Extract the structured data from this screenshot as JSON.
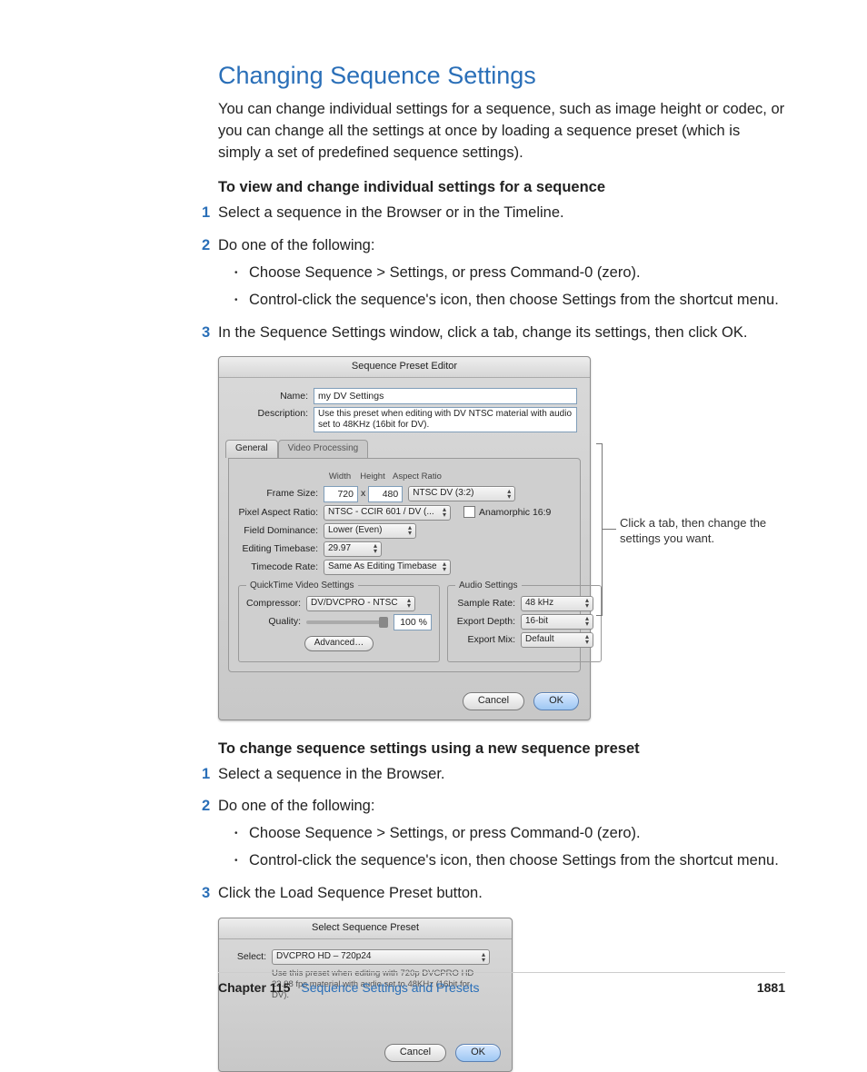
{
  "section_title": "Changing Sequence Settings",
  "intro": "You can change individual settings for a sequence, such as image height or codec, or you can change all the settings at once by loading a sequence preset (which is simply a set of predefined sequence settings).",
  "procA_head": "To view and change individual settings for a sequence",
  "procA_steps": [
    "Select a sequence in the Browser or in the Timeline.",
    "Do one of the following:",
    "In the Sequence Settings window, click a tab, change its settings, then click OK."
  ],
  "procA_sub": [
    "Choose Sequence > Settings, or press Command-0 (zero).",
    "Control-click the sequence's icon, then choose Settings from the shortcut menu."
  ],
  "dialog1": {
    "title": "Sequence Preset Editor",
    "name_label": "Name:",
    "name_value": "my DV Settings",
    "desc_label": "Description:",
    "desc_value": "Use this preset when editing with DV NTSC material with audio set to 48KHz (16bit for DV).",
    "tabs": [
      "General",
      "Video Processing"
    ],
    "heads": {
      "width": "Width",
      "height": "Height",
      "aspect": "Aspect Ratio"
    },
    "frame_label": "Frame Size:",
    "frame_w": "720",
    "frame_x": "x",
    "frame_h": "480",
    "frame_aspect": "NTSC DV (3:2)",
    "par_label": "Pixel Aspect Ratio:",
    "par_value": "NTSC - CCIR 601 / DV (...",
    "anamorphic": "Anamorphic 16:9",
    "field_label": "Field Dominance:",
    "field_value": "Lower (Even)",
    "timebase_label": "Editing Timebase:",
    "timebase_value": "29.97",
    "tcrate_label": "Timecode Rate:",
    "tcrate_value": "Same As Editing Timebase",
    "qt_legend": "QuickTime Video Settings",
    "compressor_label": "Compressor:",
    "compressor_value": "DV/DVCPRO - NTSC",
    "quality_label": "Quality:",
    "quality_value": "100 %",
    "advanced": "Advanced…",
    "audio_legend": "Audio Settings",
    "sample_label": "Sample Rate:",
    "sample_value": "48 kHz",
    "depth_label": "Export Depth:",
    "depth_value": "16-bit",
    "mix_label": "Export Mix:",
    "mix_value": "Default",
    "cancel": "Cancel",
    "ok": "OK"
  },
  "callout": "Click a tab, then change the settings you want.",
  "procB_head": "To change sequence settings using a new sequence preset",
  "procB_steps": [
    "Select a sequence in the Browser.",
    "Do one of the following:",
    "Click the Load Sequence Preset button."
  ],
  "procB_sub": [
    "Choose Sequence > Settings, or press Command-0 (zero).",
    "Control-click the sequence's icon, then choose Settings from the shortcut menu."
  ],
  "dialog2": {
    "title": "Select Sequence Preset",
    "select_label": "Select:",
    "select_value": "DVCPRO HD – 720p24",
    "desc": "Use this preset when editing with 720p DVCPRO HD 23.98 fps material with audio set to 48KHz (16bit for DV).",
    "cancel": "Cancel",
    "ok": "OK"
  },
  "footer": {
    "chapter_n": "Chapter 115",
    "chapter_t": "Sequence Settings and Presets",
    "page": "1881"
  }
}
